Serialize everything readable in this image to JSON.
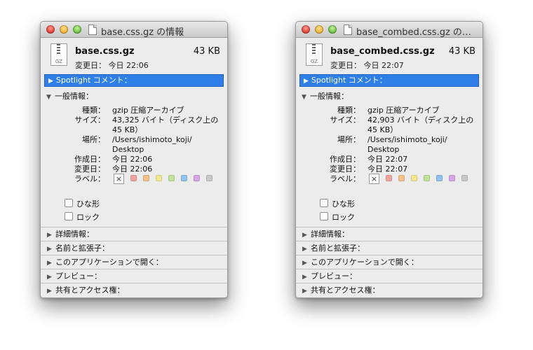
{
  "windows": [
    {
      "title": "base.css.gz の情報",
      "file_icon_label": "GZ",
      "file_name": "base.css.gz",
      "size": "43 KB",
      "modified_line": "変更日：  今日 22:06",
      "spotlight_label": "Spotlight コメント：",
      "general_header": "一般情報：",
      "info": {
        "kind_key": "種類：",
        "kind_val": "gzip 圧縮アーカイブ",
        "size_key": "サイズ：",
        "size_val": "43,325 バイト（ディスク上の 45 KB）",
        "where_key": "場所：",
        "where_val": "/Users/ishimoto_koji/ Desktop",
        "created_key": "作成日：",
        "created_val": "今日 22:06",
        "modified_key": "変更日：",
        "modified_val": "今日 22:06",
        "label_key": "ラベル：",
        "label_none": "×"
      },
      "checkbox_stationery": "ひな形",
      "checkbox_locked": "ロック",
      "sections": [
        "詳細情報：",
        "名前と拡張子：",
        "このアプリケーションで開く：",
        "プレビュー：",
        "共有とアクセス権："
      ]
    },
    {
      "title": "base_combed.css.gz の…",
      "file_icon_label": "GZ",
      "file_name": "base_combed.css.gz",
      "size": "43 KB",
      "modified_line": "変更日：  今日 22:07",
      "spotlight_label": "Spotlight コメント：",
      "general_header": "一般情報：",
      "info": {
        "kind_key": "種類：",
        "kind_val": "gzip 圧縮アーカイブ",
        "size_key": "サイズ：",
        "size_val": "42,903 バイト（ディスク上の 45 KB）",
        "where_key": "場所：",
        "where_val": "/Users/ishimoto_koji/ Desktop",
        "created_key": "作成日：",
        "created_val": "今日 22:07",
        "modified_key": "変更日：",
        "modified_val": "今日 22:07",
        "label_key": "ラベル：",
        "label_none": "×"
      },
      "checkbox_stationery": "ひな形",
      "checkbox_locked": "ロック",
      "sections": [
        "詳細情報：",
        "名前と拡張子：",
        "このアプリケーションで開く：",
        "プレビュー：",
        "共有とアクセス権："
      ]
    }
  ],
  "label_colors": [
    "#f2a3a0",
    "#f5c08a",
    "#f2e98f",
    "#bfe29a",
    "#8fc2ef",
    "#d7a6e6",
    "#c9c9c9"
  ],
  "icons": {
    "disclosure_closed": "▶",
    "disclosure_open": "▼"
  }
}
